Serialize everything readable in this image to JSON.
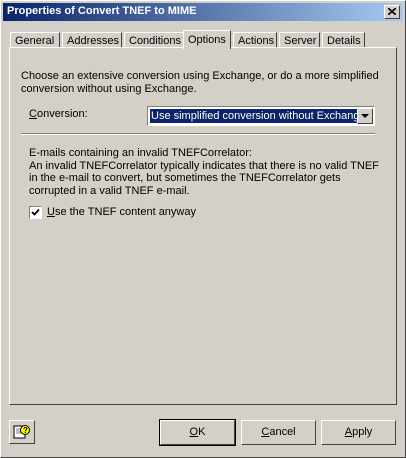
{
  "window": {
    "title": "Properties of Convert TNEF to MIME"
  },
  "tabs": [
    {
      "label": "General"
    },
    {
      "label": "Addresses"
    },
    {
      "label": "Conditions"
    },
    {
      "label": "Options"
    },
    {
      "label": "Actions"
    },
    {
      "label": "Server"
    },
    {
      "label": "Details"
    }
  ],
  "options": {
    "description": "Choose an extensive conversion using Exchange, or do a more simplified conversion without using Exchange.",
    "conversion_label_prefix": "C",
    "conversion_label_rest": "onversion:",
    "conversion_value": "Use simplified conversion without Exchange",
    "invalid_heading": "E-mails containing an invalid TNEFCorrelator:",
    "invalid_text": "An invalid TNEFCorrelator typically indicates that there is no valid TNEF in the e-mail to convert, but sometimes the TNEFCorrelator gets corrupted in a valid TNEF e-mail.",
    "checkbox_label_prefix": "U",
    "checkbox_label_rest": "se the TNEF content anyway",
    "checkbox_checked": true
  },
  "buttons": {
    "ok_u": "O",
    "ok_rest": "K",
    "cancel_u": "C",
    "cancel_rest": "ancel",
    "apply_u": "A",
    "apply_rest": "pply"
  }
}
